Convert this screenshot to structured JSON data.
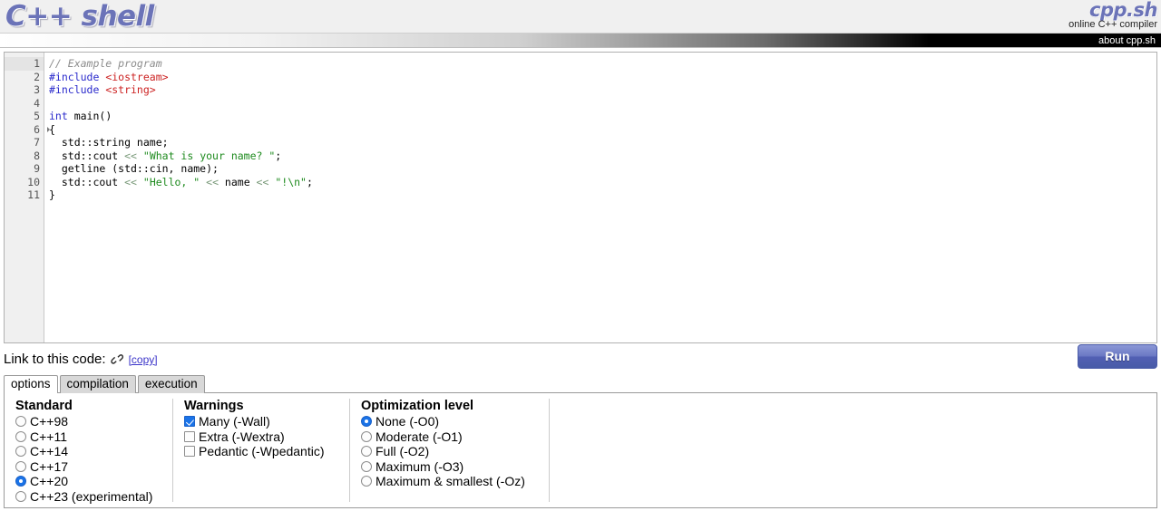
{
  "header": {
    "logo_text": "C++ shell",
    "brand_name": "cpp.sh",
    "brand_tagline": "online C++ compiler",
    "about_link": "about cpp.sh"
  },
  "editor": {
    "line_numbers": [
      "1",
      "2",
      "3",
      "4",
      "5",
      "6",
      "7",
      "8",
      "9",
      "10",
      "11"
    ],
    "lines": [
      {
        "n": "1",
        "tokens": [
          {
            "t": "// Example program",
            "c": "cmt"
          }
        ]
      },
      {
        "n": "2",
        "tokens": [
          {
            "t": "#include ",
            "c": "pre"
          },
          {
            "t": "<iostream>",
            "c": "inc"
          }
        ]
      },
      {
        "n": "3",
        "tokens": [
          {
            "t": "#include ",
            "c": "pre"
          },
          {
            "t": "<string>",
            "c": "inc"
          }
        ]
      },
      {
        "n": "4",
        "tokens": [
          {
            "t": "",
            "c": "pl"
          }
        ]
      },
      {
        "n": "5",
        "tokens": [
          {
            "t": "int",
            "c": "kw"
          },
          {
            "t": " main()",
            "c": "pl"
          }
        ]
      },
      {
        "n": "6",
        "tokens": [
          {
            "t": "{",
            "c": "pl"
          }
        ]
      },
      {
        "n": "7",
        "tokens": [
          {
            "t": "  std::string name;",
            "c": "pl"
          }
        ]
      },
      {
        "n": "8",
        "tokens": [
          {
            "t": "  std::cout ",
            "c": "pl"
          },
          {
            "t": "<<",
            "c": "op"
          },
          {
            "t": " ",
            "c": "pl"
          },
          {
            "t": "\"What is your name? \"",
            "c": "str"
          },
          {
            "t": ";",
            "c": "pl"
          }
        ]
      },
      {
        "n": "9",
        "tokens": [
          {
            "t": "  getline (std::cin, name);",
            "c": "pl"
          }
        ]
      },
      {
        "n": "10",
        "tokens": [
          {
            "t": "  std::cout ",
            "c": "pl"
          },
          {
            "t": "<<",
            "c": "op"
          },
          {
            "t": " ",
            "c": "pl"
          },
          {
            "t": "\"Hello, \"",
            "c": "str"
          },
          {
            "t": " ",
            "c": "pl"
          },
          {
            "t": "<<",
            "c": "op"
          },
          {
            "t": " name ",
            "c": "pl"
          },
          {
            "t": "<<",
            "c": "op"
          },
          {
            "t": " ",
            "c": "pl"
          },
          {
            "t": "\"!\\n\"",
            "c": "str"
          },
          {
            "t": ";",
            "c": "pl"
          }
        ]
      },
      {
        "n": "11",
        "tokens": [
          {
            "t": "}",
            "c": "pl"
          }
        ]
      }
    ]
  },
  "link_row": {
    "label": "Link to this code:",
    "link_icon": "chain-link-icon",
    "copy_label": "[copy]",
    "run_label": "Run"
  },
  "tabs": [
    {
      "label": "options",
      "active": true
    },
    {
      "label": "compilation",
      "active": false
    },
    {
      "label": "execution",
      "active": false
    }
  ],
  "options": {
    "standard": {
      "title": "Standard",
      "items": [
        {
          "label": "C++98",
          "selected": false
        },
        {
          "label": "C++11",
          "selected": false
        },
        {
          "label": "C++14",
          "selected": false
        },
        {
          "label": "C++17",
          "selected": false
        },
        {
          "label": "C++20",
          "selected": true
        },
        {
          "label": "C++23 (experimental)",
          "selected": false
        }
      ]
    },
    "warnings": {
      "title": "Warnings",
      "items": [
        {
          "label": "Many (-Wall)",
          "checked": true
        },
        {
          "label": "Extra (-Wextra)",
          "checked": false
        },
        {
          "label": "Pedantic (-Wpedantic)",
          "checked": false
        }
      ]
    },
    "optimization": {
      "title": "Optimization level",
      "items": [
        {
          "label": "None (-O0)",
          "selected": true
        },
        {
          "label": "Moderate (-O1)",
          "selected": false
        },
        {
          "label": "Full (-O2)",
          "selected": false
        },
        {
          "label": "Maximum (-O3)",
          "selected": false
        },
        {
          "label": "Maximum & smallest (-Oz)",
          "selected": false
        }
      ]
    }
  },
  "colors": {
    "brand_blue": "#6b73b8",
    "accent_blue": "#1a73e8",
    "run_button": "#5260b4",
    "link": "#3b34c9",
    "comment": "#8c8c8c",
    "preprocessor": "#2b2bcc",
    "include_path": "#cc2222",
    "string": "#1d8a1d",
    "operator": "#7a9a7a"
  }
}
